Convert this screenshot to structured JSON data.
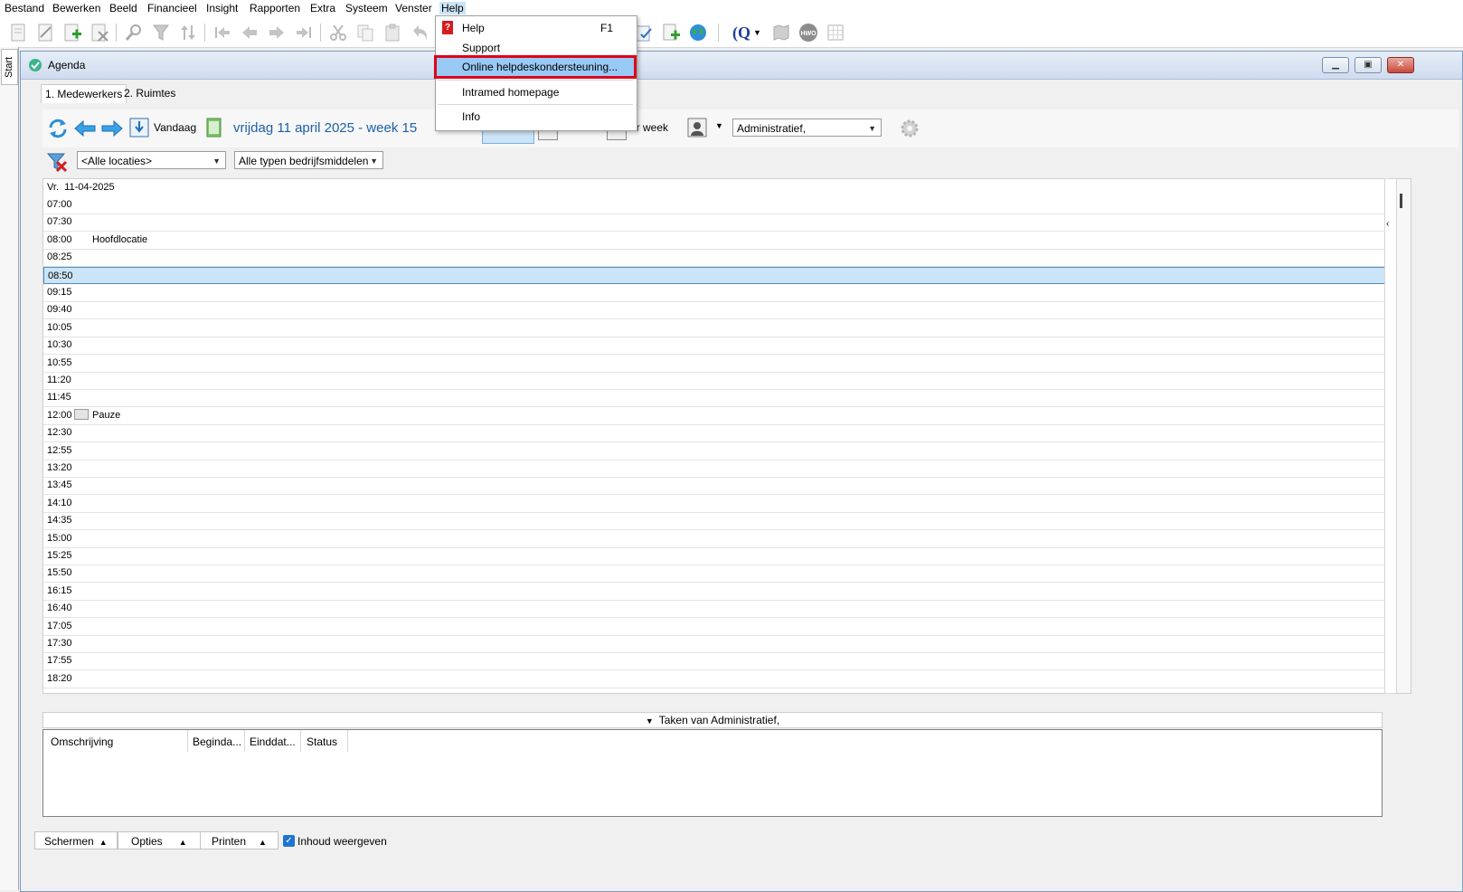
{
  "menubar": {
    "items": [
      "Bestand",
      "Bewerken",
      "Beeld",
      "Financieel",
      "Insight",
      "Rapporten",
      "Extra",
      "Systeem",
      "Venster",
      "Help"
    ]
  },
  "sidebar": {
    "start_tab": "Start"
  },
  "window": {
    "title": "Agenda",
    "tabs": [
      "1. Medewerkers",
      "2. Ruimtes"
    ]
  },
  "nav": {
    "today_label": "Vandaag",
    "date_label": "vrijdag 11 april 2025 - week 15",
    "view_week_label": "er week",
    "staff_select": "Administratief,",
    "location_select": "<Alle locaties>",
    "resource_select": "Alle typen bedrijfsmiddelen"
  },
  "agenda": {
    "day_header": "Vr.  11-04-2025",
    "slots": [
      {
        "time": "07:00",
        "label": ""
      },
      {
        "time": "07:30",
        "label": ""
      },
      {
        "time": "08:00",
        "label": "Hoofdlocatie"
      },
      {
        "time": "08:25",
        "label": ""
      },
      {
        "time": "08:50",
        "label": "",
        "selected": true
      },
      {
        "time": "09:15",
        "label": ""
      },
      {
        "time": "09:40",
        "label": ""
      },
      {
        "time": "10:05",
        "label": ""
      },
      {
        "time": "10:30",
        "label": ""
      },
      {
        "time": "10:55",
        "label": ""
      },
      {
        "time": "11:20",
        "label": ""
      },
      {
        "time": "11:45",
        "label": ""
      },
      {
        "time": "12:00",
        "label": "Pauze",
        "icon": "pause-icon"
      },
      {
        "time": "12:30",
        "label": ""
      },
      {
        "time": "12:55",
        "label": ""
      },
      {
        "time": "13:20",
        "label": ""
      },
      {
        "time": "13:45",
        "label": ""
      },
      {
        "time": "14:10",
        "label": ""
      },
      {
        "time": "14:35",
        "label": ""
      },
      {
        "time": "15:00",
        "label": ""
      },
      {
        "time": "15:25",
        "label": ""
      },
      {
        "time": "15:50",
        "label": ""
      },
      {
        "time": "16:15",
        "label": ""
      },
      {
        "time": "16:40",
        "label": ""
      },
      {
        "time": "17:05",
        "label": ""
      },
      {
        "time": "17:30",
        "label": ""
      },
      {
        "time": "17:55",
        "label": ""
      },
      {
        "time": "18:20",
        "label": ""
      }
    ]
  },
  "tasks": {
    "header": "Taken van Administratief,",
    "columns": [
      "Omschrijving",
      "Beginda...",
      "Einddat...",
      "Status"
    ]
  },
  "bottom": {
    "screens_label": "Schermen",
    "options_label": "Opties",
    "print_label": "Printen",
    "show_content_label": "Inhoud weergeven",
    "show_content_checked": true
  },
  "help_menu": {
    "items": [
      {
        "label": "Help",
        "shortcut": "F1"
      },
      {
        "label": "Support",
        "shortcut": ""
      },
      {
        "label": "Online helpdeskondersteuning...",
        "shortcut": "",
        "highlighted": true
      },
      {
        "label": "Intramed homepage",
        "shortcut": ""
      },
      {
        "label": "Info",
        "shortcut": ""
      }
    ]
  },
  "colors": {
    "accent_blue": "#1e73be",
    "selection_bg": "#cce4f7",
    "highlight_border": "#e0001a",
    "menu_hover": "#99c9f5"
  }
}
